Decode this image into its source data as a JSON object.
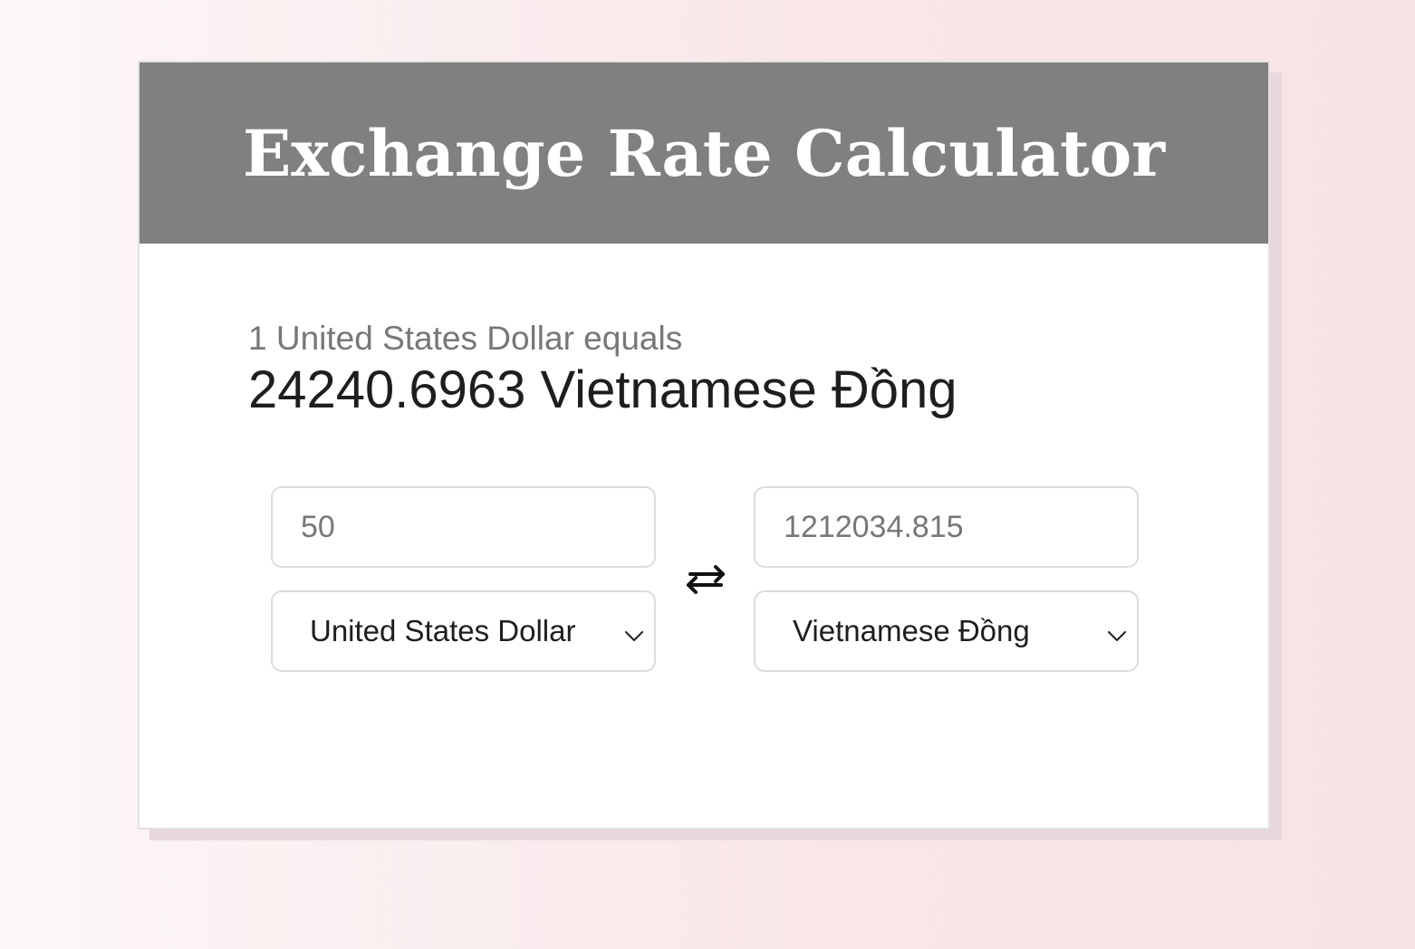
{
  "header": {
    "title": "Exchange Rate Calculator"
  },
  "rate": {
    "from_text": "1 United States Dollar equals",
    "to_text": "24240.6963 Vietnamese Đồng"
  },
  "converter": {
    "from_amount": "50",
    "to_amount": "1212034.815",
    "from_currency": "United States Dollar",
    "to_currency": "Vietnamese Đồng",
    "swap_icon": "swap-arrows-icon",
    "dropdown_icon": "chevron-down-icon"
  },
  "colors": {
    "header_bg": "#808080",
    "card_bg": "#ffffff",
    "page_bg_start": "#fcf7f7",
    "page_bg_end": "#f7e2e5"
  }
}
